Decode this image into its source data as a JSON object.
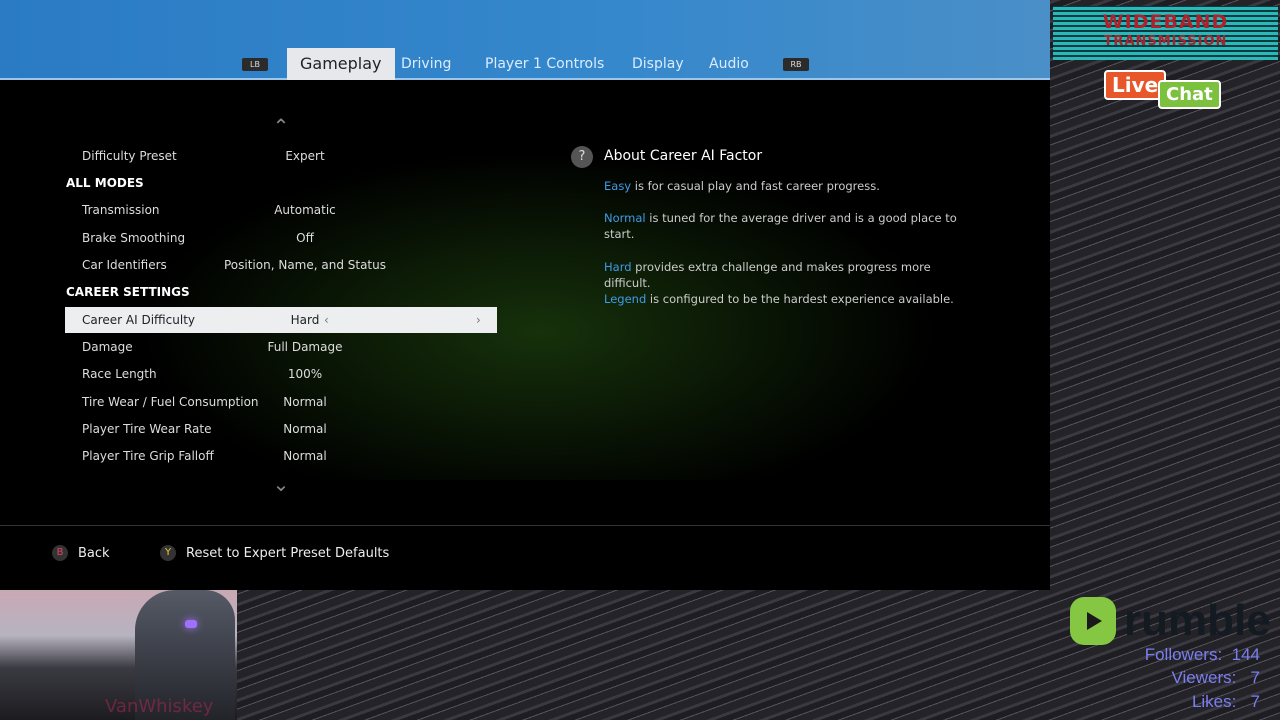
{
  "tabs": {
    "lb": "LB",
    "rb": "RB",
    "items": [
      "Gameplay",
      "Driving",
      "Player 1 Controls",
      "Display",
      "Audio"
    ],
    "active": "Gameplay"
  },
  "settings": [
    {
      "label": "Difficulty Preset",
      "value": "Expert"
    },
    {
      "label": "ALL MODES",
      "header": true
    },
    {
      "label": "Transmission",
      "value": "Automatic"
    },
    {
      "label": "Brake Smoothing",
      "value": "Off"
    },
    {
      "label": "Car Identifiers",
      "value": "Position, Name, and Status"
    },
    {
      "label": "CAREER SETTINGS",
      "header": true
    },
    {
      "label": "Career AI Difficulty",
      "value": "Hard",
      "selected": true
    },
    {
      "label": "Damage",
      "value": "Full Damage"
    },
    {
      "label": "Race Length",
      "value": "100%"
    },
    {
      "label": "Tire Wear / Fuel Consumption",
      "value": "Normal"
    },
    {
      "label": "Player Tire Wear Rate",
      "value": "Normal"
    },
    {
      "label": "Player Tire Grip Falloff",
      "value": "Normal"
    }
  ],
  "info": {
    "title": "About Career AI Factor",
    "paras": [
      {
        "key": "Easy",
        "text": " is for casual play and fast career progress."
      },
      {
        "key": "Normal",
        "text": " is tuned for the average driver and is a good place to start."
      },
      {
        "key": "Hard",
        "text": " provides extra challenge and makes progress more difficult."
      },
      {
        "key": "Legend",
        "text": " is configured to be the hardest experience available."
      }
    ]
  },
  "footer": {
    "back_key": "B",
    "back": "Back",
    "reset_key": "Y",
    "reset": "Reset to Expert Preset Defaults"
  },
  "overlay": {
    "logo_line1": "WIDEBAND",
    "logo_line2": "TRANSMISSION",
    "live": "Live",
    "chat": "Chat",
    "rumble": "rumble",
    "webcam_name": "VanWhiskey",
    "followers_label": "Followers:",
    "followers": "144",
    "viewers_label": "Viewers:",
    "viewers": "7",
    "likes_label": "Likes:",
    "likes": "7"
  },
  "colors": {
    "accent": "#3f9be8",
    "tabbar": "#2f82c8",
    "rumble_green": "#85c742"
  }
}
